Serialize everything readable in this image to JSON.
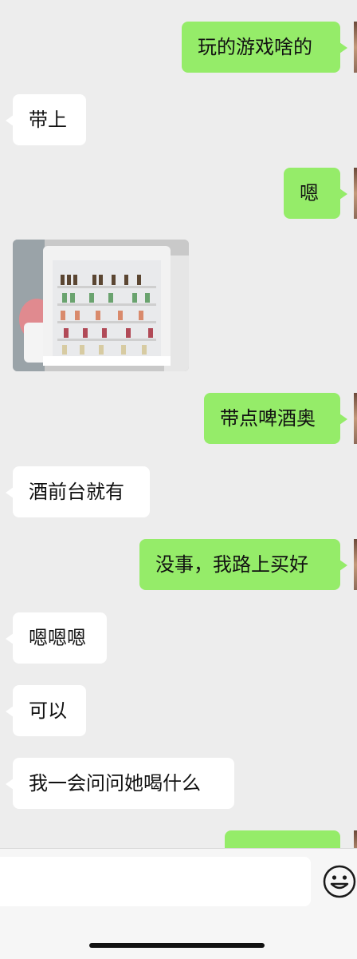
{
  "messages": [
    {
      "side": "out",
      "text": "玩的游戏啥的"
    },
    {
      "side": "in",
      "text": "带上"
    },
    {
      "side": "out",
      "text": "嗯"
    },
    {
      "side": "in",
      "type": "image",
      "image": "drinks-fridge-photo"
    },
    {
      "side": "out",
      "text": "带点啤酒奥"
    },
    {
      "side": "in",
      "text": "酒前台就有"
    },
    {
      "side": "out",
      "text": "没事，我路上买好"
    },
    {
      "side": "in",
      "text": "嗯嗯嗯"
    },
    {
      "side": "in",
      "text": "可以"
    },
    {
      "side": "in",
      "text": "我一会问问她喝什么"
    },
    {
      "side": "out",
      "text": ""
    }
  ],
  "input": {
    "value": "",
    "placeholder": ""
  },
  "icons": {
    "emoji": "smiley-face-icon"
  },
  "colors": {
    "outgoing_bubble": "#95ec69",
    "incoming_bubble": "#ffffff",
    "background": "#ededed"
  }
}
